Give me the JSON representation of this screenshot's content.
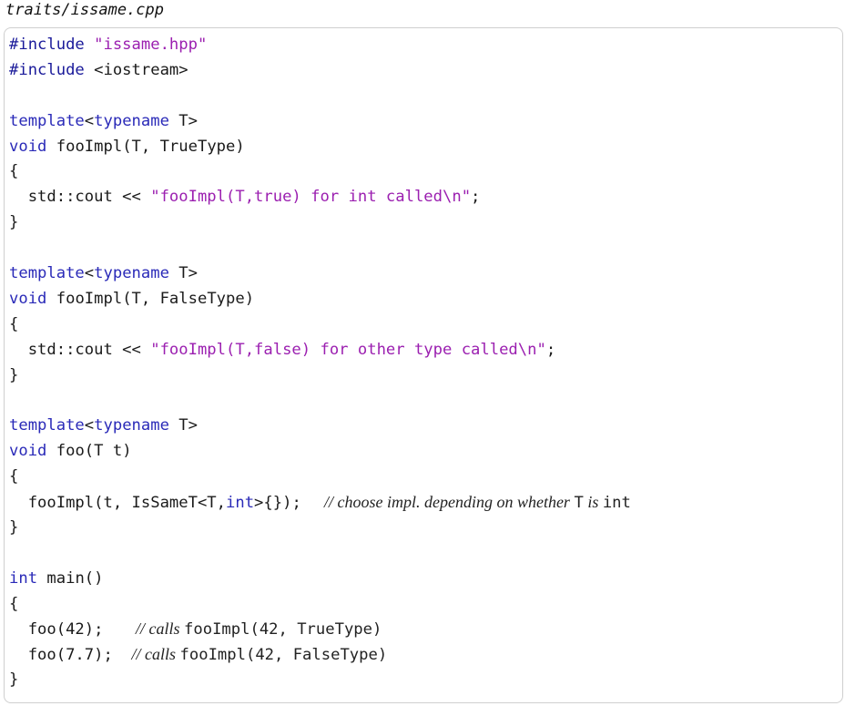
{
  "document": {
    "file_title": "traits/issame.cpp",
    "code_lines": [
      [
        {
          "t": "#include ",
          "k": "directive"
        },
        {
          "t": "\"issame.hpp\"",
          "k": "string"
        }
      ],
      [
        {
          "t": "#include ",
          "k": "directive"
        },
        {
          "t": "<iostream>",
          "k": "plain"
        }
      ],
      [],
      [
        {
          "t": "template",
          "k": "keyword"
        },
        {
          "t": "<",
          "k": "plain"
        },
        {
          "t": "typename",
          "k": "keyword"
        },
        {
          "t": " T>",
          "k": "plain"
        }
      ],
      [
        {
          "t": "void",
          "k": "keyword"
        },
        {
          "t": " fooImpl(T, TrueType)",
          "k": "plain"
        }
      ],
      [
        {
          "t": "{",
          "k": "plain"
        }
      ],
      [
        {
          "t": "  std::cout << ",
          "k": "plain"
        },
        {
          "t": "\"fooImpl(T,true) for int called\\n\"",
          "k": "string"
        },
        {
          "t": ";",
          "k": "plain"
        }
      ],
      [
        {
          "t": "}",
          "k": "plain"
        }
      ],
      [],
      [
        {
          "t": "template",
          "k": "keyword"
        },
        {
          "t": "<",
          "k": "plain"
        },
        {
          "t": "typename",
          "k": "keyword"
        },
        {
          "t": " T>",
          "k": "plain"
        }
      ],
      [
        {
          "t": "void",
          "k": "keyword"
        },
        {
          "t": " fooImpl(T, FalseType)",
          "k": "plain"
        }
      ],
      [
        {
          "t": "{",
          "k": "plain"
        }
      ],
      [
        {
          "t": "  std::cout << ",
          "k": "plain"
        },
        {
          "t": "\"fooImpl(T,false) for other type called\\n\"",
          "k": "string"
        },
        {
          "t": ";",
          "k": "plain"
        }
      ],
      [
        {
          "t": "}",
          "k": "plain"
        }
      ],
      [],
      [
        {
          "t": "template",
          "k": "keyword"
        },
        {
          "t": "<",
          "k": "plain"
        },
        {
          "t": "typename",
          "k": "keyword"
        },
        {
          "t": " T>",
          "k": "plain"
        }
      ],
      [
        {
          "t": "void",
          "k": "keyword"
        },
        {
          "t": " foo(T t)",
          "k": "plain"
        }
      ],
      [
        {
          "t": "{",
          "k": "plain"
        }
      ],
      [
        {
          "t": "  fooImpl(t, IsSameT<T,",
          "k": "plain"
        },
        {
          "t": "int",
          "k": "keyword"
        },
        {
          "t": ">{});  ",
          "k": "plain"
        },
        {
          "t": " // choose impl. depending on whether ",
          "k": "comment"
        },
        {
          "t": "T",
          "k": "comment-code"
        },
        {
          "t": " is ",
          "k": "comment"
        },
        {
          "t": "int",
          "k": "comment-code"
        }
      ],
      [
        {
          "t": "}",
          "k": "plain"
        }
      ],
      [],
      [
        {
          "t": "int",
          "k": "keyword"
        },
        {
          "t": " main()",
          "k": "plain"
        }
      ],
      [
        {
          "t": "{",
          "k": "plain"
        }
      ],
      [
        {
          "t": "  foo(42);   ",
          "k": "plain"
        },
        {
          "t": " // calls ",
          "k": "comment"
        },
        {
          "t": "fooImpl(42, TrueType)",
          "k": "comment-code"
        }
      ],
      [
        {
          "t": "  foo(7.7);  ",
          "k": "plain"
        },
        {
          "t": "// calls ",
          "k": "comment"
        },
        {
          "t": "fooImpl(42, FalseType)",
          "k": "comment-code"
        }
      ],
      [
        {
          "t": "}",
          "k": "plain"
        }
      ]
    ]
  }
}
